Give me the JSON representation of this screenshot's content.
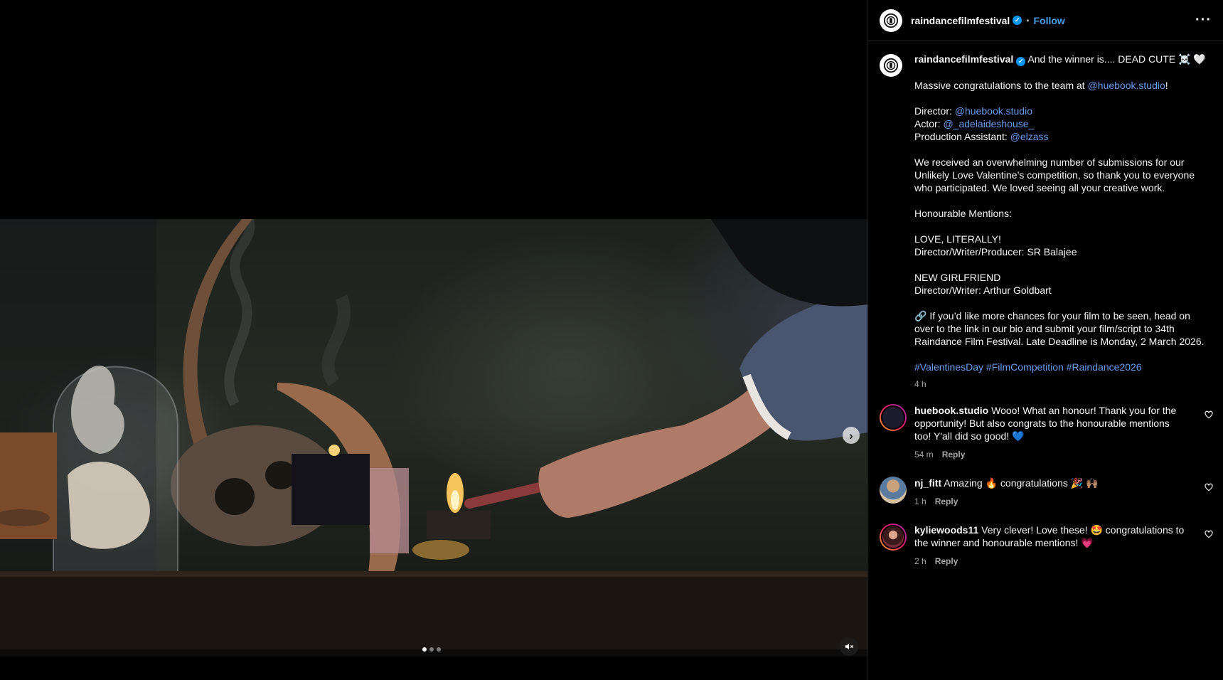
{
  "media": {
    "next_icon": "chevron-right-icon",
    "mute_icon": "speaker-muted-icon",
    "carousel": {
      "count": 3,
      "active": 0
    }
  },
  "header": {
    "username": "raindancefilmfestival",
    "separator": "•",
    "follow_label": "Follow",
    "more_label": "···"
  },
  "post": {
    "username": "raindancefilmfestival",
    "headline": "And the winner is.... DEAD CUTE ☠️ 🤍",
    "congrats_prefix": "Massive congratulations to the team at ",
    "congrats_link": "@huebook.studio",
    "congrats_suffix": "!",
    "credits": [
      {
        "role": "Director: ",
        "handle": "@huebook.studio"
      },
      {
        "role": "Actor: ",
        "handle": "@_adelaideshouse_"
      },
      {
        "role": "Production Assistant: ",
        "handle": "@elzass"
      }
    ],
    "body_lines": [
      "We received an overwhelming number of submissions for our",
      "Unlikely Love Valentine’s competition, so thank you to everyone",
      "who participated. We loved seeing all your creative work."
    ],
    "mentions_heading": "Honourable Mentions:",
    "mention1_title": "LOVE, LITERALLY!",
    "mention1_credit": "Director/Writer/Producer: SR Balajee",
    "mention2_title": "NEW GIRLFRIEND",
    "mention2_credit": "Director/Writer: Arthur Goldbart",
    "cta_lines": [
      "🔗 If you’d like more chances for your film to be seen, head on",
      "over to the link in our bio and submit your film/script to 34th",
      "Raindance Film Festival. Late Deadline is Monday, 2 March 2026."
    ],
    "hashtags": "#ValentinesDay #FilmCompetition #Raindance2026",
    "time": "4 h"
  },
  "comments": [
    {
      "username": "huebook.studio",
      "text": "Wooo! What an honour! Thank you for the",
      "text2": "opportunity! But also congrats to the honourable mentions",
      "text3": "too! Y'all did so good! 💙",
      "time": "54 m",
      "reply": "Reply"
    },
    {
      "username": "nj_fitt",
      "text": "Amazing 🔥 congratulations 🎉 🙌🏽",
      "time": "1 h",
      "reply": "Reply"
    },
    {
      "username": "kyliewoods11",
      "text": "Very clever! Love these! 🤩 congratulations to",
      "text2": "the winner and honourable mentions! 💗",
      "time": "2 h",
      "reply": "Reply"
    }
  ],
  "colors": {
    "link": "#6b9cf0",
    "follow": "#4a9df0",
    "verified": "#0095f6",
    "muted_text": "#a8a8a8"
  }
}
